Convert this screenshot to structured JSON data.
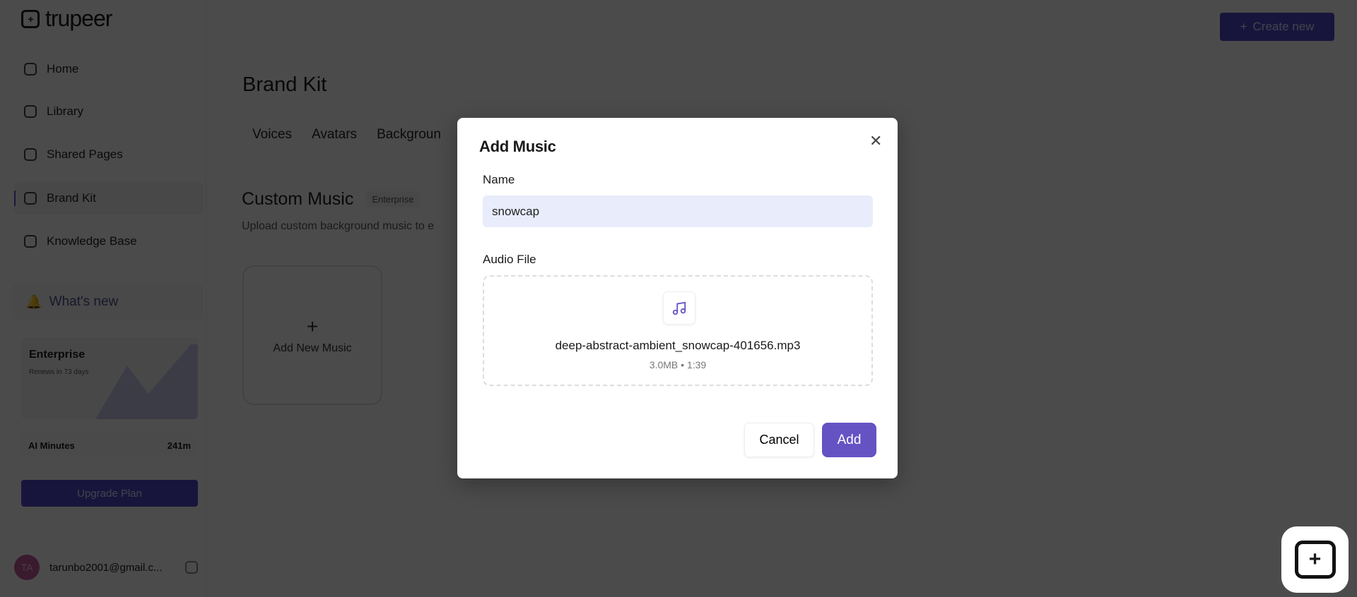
{
  "app": {
    "logo": "trupeer",
    "create_new": "Create new"
  },
  "sidebar": {
    "items": [
      {
        "label": "Home"
      },
      {
        "label": "Library"
      },
      {
        "label": "Shared Pages"
      },
      {
        "label": "Brand Kit"
      },
      {
        "label": "Knowledge Base"
      }
    ],
    "whats_new": "What's new",
    "plan": {
      "name": "Enterprise",
      "renews": "Renews in 73 days",
      "ai_minutes_label": "AI Minutes",
      "ai_minutes_value": "241m",
      "upgrade": "Upgrade Plan"
    },
    "user": {
      "initials": "TA",
      "email": "tarunbo2001@gmail.c..."
    }
  },
  "main": {
    "title": "Brand Kit",
    "tabs": [
      "Voices",
      "Avatars",
      "Backgroun"
    ],
    "section_title": "Custom Music",
    "badge": "Enterprise",
    "subtitle": "Upload custom background music to e",
    "add_card": "Add New Music"
  },
  "modal": {
    "title": "Add Music",
    "name_label": "Name",
    "name_value": "snowcap",
    "audio_label": "Audio File",
    "file_name": "deep-abstract-ambient_snowcap-401656.mp3",
    "file_meta": "3.0MB • 1:39",
    "cancel": "Cancel",
    "add": "Add"
  },
  "colors": {
    "accent": "#6553c4"
  }
}
